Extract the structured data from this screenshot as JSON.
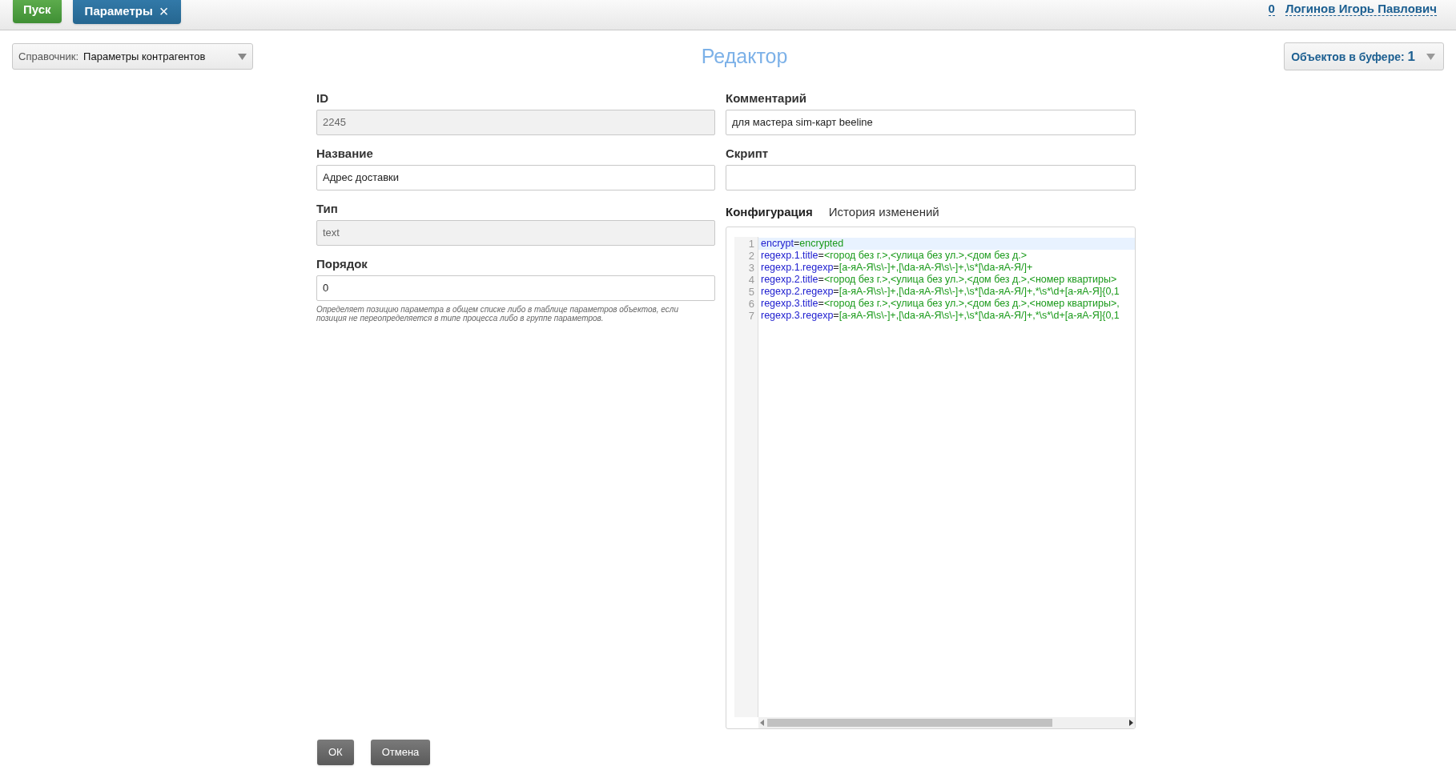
{
  "top_bar": {
    "start_button": "Пуск",
    "tabs": [
      {
        "label": "Параметры",
        "close": "×",
        "selected": true
      }
    ],
    "counter": "0",
    "user": "Логинов Игорь Павлович"
  },
  "toolbar": {
    "directory": {
      "label": "Справочник:",
      "value": "Параметры контрагентов"
    },
    "title": "Редактор",
    "buffer": {
      "label": "Объектов в буфере:",
      "count": "1"
    }
  },
  "left_fields": [
    {
      "label": "ID",
      "value": "2245",
      "disabled": true
    },
    {
      "label": "Название",
      "value": "Адрес доставки",
      "disabled": false
    },
    {
      "label": "Тип",
      "value": "text",
      "disabled": true
    },
    {
      "label": "Порядок",
      "value": "0",
      "disabled": false,
      "hint": "Определяет позицию параметра в общем списке либо в таблице параметров объектов, если позиция не переопределяется в типе процесса либо в группе параметров."
    }
  ],
  "right_fields": [
    {
      "label": "Комментарий",
      "value": "для мастера sim-карт beeline"
    },
    {
      "label": "Скрипт"
    }
  ],
  "editor_tabs": [
    {
      "label": "Конфигурация",
      "selected": true
    },
    {
      "label": "История изменений",
      "selected": false
    }
  ],
  "code_lines": [
    {
      "number": "1",
      "key": "encrypt",
      "separator": "=",
      "value": "encrypted",
      "active": true
    },
    {
      "number": "2",
      "key": "regexp.1.title",
      "separator": "=",
      "value": "<город без г.>,<улица без ул.>,<дом без д.>",
      "active": false
    },
    {
      "number": "3",
      "key": "regexp.1.regexp",
      "separator": "=",
      "value": "[a-яА-Я\\s\\-]+,[\\da-яА-Я\\s\\-]+,\\s*[\\da-яА-Я/]+",
      "active": false
    },
    {
      "number": "4",
      "key": "regexp.2.title",
      "separator": "=",
      "value": "<город без г.>,<улица без ул.>,<дом без д.>,<номер квартиры>",
      "active": false
    },
    {
      "number": "5",
      "key": "regexp.2.regexp",
      "separator": "=",
      "value": "[a-яА-Я\\s\\-]+,[\\da-яА-Я\\s\\-]+,\\s*[\\da-яА-Я/]+,*\\s*\\d+[a-яА-Я]{0,1",
      "active": false
    },
    {
      "number": "6",
      "key": "regexp.3.title",
      "separator": "=",
      "value": "<город без г.>,<улица без ул.>,<дом без д.>,<номер квартиры>,",
      "active": false
    },
    {
      "number": "7",
      "key": "regexp.3.regexp",
      "separator": "=",
      "value": "[a-яА-Я\\s\\-]+,[\\da-яА-Я\\s\\-]+,\\s*[\\da-яА-Я/]+,*\\s*\\d+[a-яА-Я]{0,1",
      "active": false
    }
  ],
  "buttons": [
    "ОК",
    "Отмена"
  ]
}
